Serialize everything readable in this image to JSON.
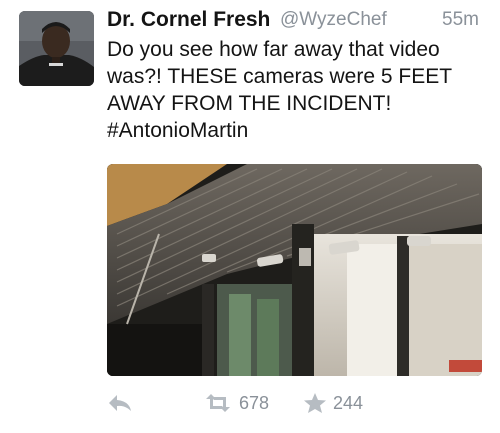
{
  "tweet": {
    "display_name": "Dr. Cornel Fresh",
    "handle": "@WyzeChef",
    "timestamp": "55m",
    "text_lines": [
      "Do you see how far away that video",
      "was?! THESE cameras were 5 FEET",
      "AWAY FROM THE INCIDENT!",
      "#AntonioMartin"
    ],
    "retweet_count": "678",
    "favorite_count": "244"
  },
  "icons": {
    "reply": "reply-icon",
    "retweet": "retweet-icon",
    "favorite": "star-icon"
  },
  "colors": {
    "name_text": "#141414",
    "meta_text": "#8a9199",
    "icon_gray": "#b6bcc2"
  }
}
